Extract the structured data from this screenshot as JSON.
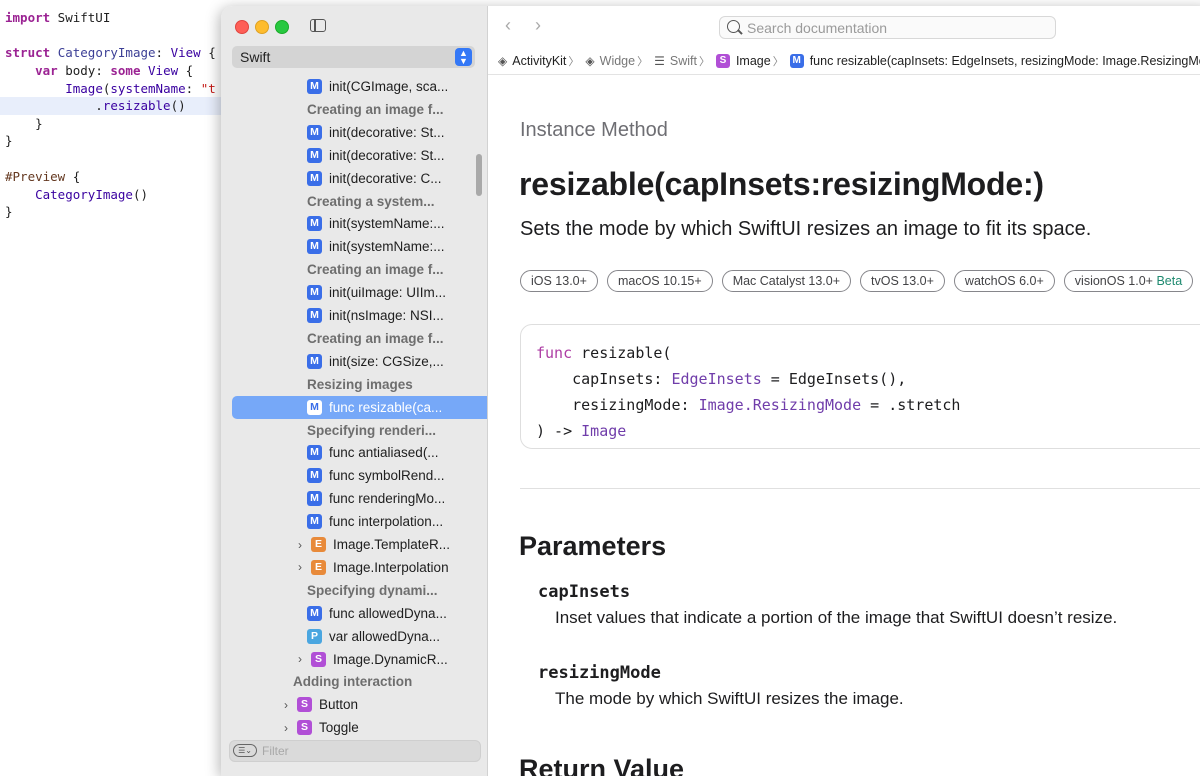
{
  "editor": {
    "lines": [
      {
        "text": "import SwiftUI"
      },
      {
        "text": ""
      },
      {
        "text": "struct CategoryImage: View {"
      },
      {
        "text": "    var body: some View {"
      },
      {
        "text": "        Image(systemName: \"t"
      },
      {
        "text": "            .resizable()"
      },
      {
        "text": "    }"
      },
      {
        "text": "}"
      },
      {
        "text": ""
      },
      {
        "text": "#Preview {"
      },
      {
        "text": "    CategoryImage()"
      },
      {
        "text": "}"
      }
    ]
  },
  "sidebar": {
    "language": "Swift",
    "filter_placeholder": "Filter",
    "items": [
      {
        "kind": "M",
        "label": "init(CGImage, sca...",
        "header": false
      },
      {
        "label": "Creating an image f...",
        "header": true
      },
      {
        "kind": "M",
        "label": "init(decorative: St...",
        "header": false
      },
      {
        "kind": "M",
        "label": "init(decorative: St...",
        "header": false
      },
      {
        "kind": "M",
        "label": "init(decorative: C...",
        "header": false
      },
      {
        "label": "Creating a system...",
        "header": true
      },
      {
        "kind": "M",
        "label": "init(systemName:...",
        "header": false
      },
      {
        "kind": "M",
        "label": "init(systemName:...",
        "header": false
      },
      {
        "label": "Creating an image f...",
        "header": true
      },
      {
        "kind": "M",
        "label": "init(uiImage: UIIm...",
        "header": false
      },
      {
        "kind": "M",
        "label": "init(nsImage: NSI...",
        "header": false
      },
      {
        "label": "Creating an image f...",
        "header": true
      },
      {
        "kind": "M",
        "label": "init(size: CGSize,...",
        "header": false
      },
      {
        "label": "Resizing images",
        "header": true
      },
      {
        "kind": "M",
        "label": "func resizable(ca...",
        "header": false,
        "selected": true
      },
      {
        "label": "Specifying renderi...",
        "header": true
      },
      {
        "kind": "M",
        "label": "func antialiased(...",
        "header": false
      },
      {
        "kind": "M",
        "label": "func symbolRend...",
        "header": false
      },
      {
        "kind": "M",
        "label": "func renderingMo...",
        "header": false
      },
      {
        "kind": "M",
        "label": "func interpolation...",
        "header": false
      },
      {
        "kind": "E",
        "label": "Image.TemplateR...",
        "header": false,
        "expandable": true
      },
      {
        "kind": "E",
        "label": "Image.Interpolation",
        "header": false,
        "expandable": true
      },
      {
        "label": "Specifying dynami...",
        "header": true
      },
      {
        "kind": "M",
        "label": "func allowedDyna...",
        "header": false
      },
      {
        "kind": "P",
        "label": "var allowedDyna...",
        "header": false
      },
      {
        "kind": "S",
        "label": "Image.DynamicR...",
        "header": false,
        "expandable": true
      },
      {
        "label": "Adding interaction",
        "header": true,
        "outdent": true
      },
      {
        "kind": "S",
        "label": "Button",
        "header": false,
        "expandable": true,
        "outdent": true
      },
      {
        "kind": "S",
        "label": "Toggle",
        "header": false,
        "expandable": true,
        "outdent": true
      }
    ]
  },
  "toolbar": {
    "search_placeholder": "Search documentation",
    "back": "‹",
    "forward": "›"
  },
  "breadcrumb": [
    {
      "icon": "stack",
      "label": "ActivityKit"
    },
    {
      "icon": "stack",
      "label": "Widg⁠e"
    },
    {
      "icon": "list",
      "label": "Swift⁠"
    },
    {
      "badge": "S",
      "label": "Image"
    },
    {
      "badge": "M",
      "label": "func resizable(capInsets: EdgeInsets, resizingMode: Image.ResizingMo"
    }
  ],
  "doc": {
    "eyebrow": "Instance Method",
    "title": "resizable(capInsets:resizingMode:)",
    "abstract": "Sets the mode by which SwiftUI resizes an image to fit its space.",
    "platforms": [
      "iOS 13.0+",
      "macOS 10.15+",
      "Mac Catalyst 13.0+",
      "tvOS 13.0+",
      "watchOS 6.0+",
      "visionOS 1.0+"
    ],
    "beta_label": "Beta",
    "declaration": {
      "l1_kw": "func",
      "l1_rest": " resizable(",
      "l2_a": "    capInsets: ",
      "l2_ty": "EdgeInsets",
      "l2_b": " = EdgeInsets(),",
      "l3_a": "    resizingMode: ",
      "l3_ty1": "Image",
      "l3_dot": ".",
      "l3_ty2": "ResizingMode",
      "l3_b": " = .stretch",
      "l4_a": ") -> ",
      "l4_ty": "Image"
    },
    "parameters_heading": "Parameters",
    "parameters": [
      {
        "name": "capInsets",
        "desc": "Inset values that indicate a portion of the image that SwiftUI doesn’t resize."
      },
      {
        "name": "resizingMode",
        "desc": "The mode by which SwiftUI resizes the image."
      }
    ],
    "return_heading": "Return Value"
  }
}
